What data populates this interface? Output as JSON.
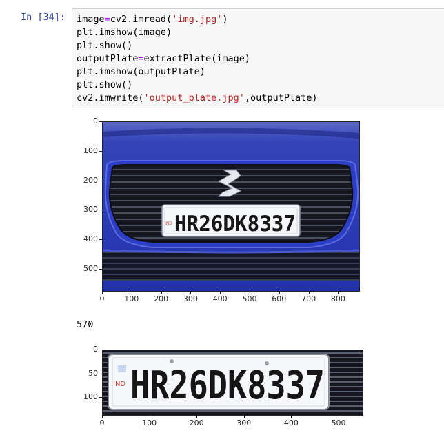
{
  "cell": {
    "prompt": "In [34]:",
    "code_lines": [
      [
        {
          "t": "image"
        },
        {
          "t": "=",
          "c": "op"
        },
        {
          "t": "cv2.imread("
        },
        {
          "t": "'img.jpg'",
          "c": "str"
        },
        {
          "t": ")"
        }
      ],
      [
        {
          "t": "plt.imshow(image)"
        }
      ],
      [
        {
          "t": "plt.show()"
        }
      ],
      [
        {
          "t": "outputPlate"
        },
        {
          "t": "=",
          "c": "op"
        },
        {
          "t": "extractPlate(image)"
        }
      ],
      [
        {
          "t": "plt.imshow(outputPlate)"
        }
      ],
      [
        {
          "t": "plt.show()"
        }
      ],
      [
        {
          "t": "cv2.imwrite("
        },
        {
          "t": "'output_plate.jpg'",
          "c": "str"
        },
        {
          "t": ",outputPlate)"
        }
      ]
    ]
  },
  "plot1": {
    "y_ticks": [
      "0",
      "100",
      "200",
      "300",
      "400",
      "500"
    ],
    "x_ticks": [
      "0",
      "100",
      "200",
      "300",
      "400",
      "500",
      "600",
      "700",
      "800"
    ],
    "plate_text": "HR26DK8337",
    "plate_badge": "IND"
  },
  "printed_output": "570",
  "plot2": {
    "y_ticks": [
      "0",
      "50",
      "100"
    ],
    "x_ticks": [
      "0",
      "100",
      "200",
      "300",
      "400",
      "500"
    ],
    "plate_text": "HR26DK8337",
    "plate_badge": "IND"
  },
  "colors": {
    "prompt": "#303f9f",
    "operator": "#aa22ff",
    "string": "#ba2121",
    "car_blue": "#2a3bb8"
  }
}
